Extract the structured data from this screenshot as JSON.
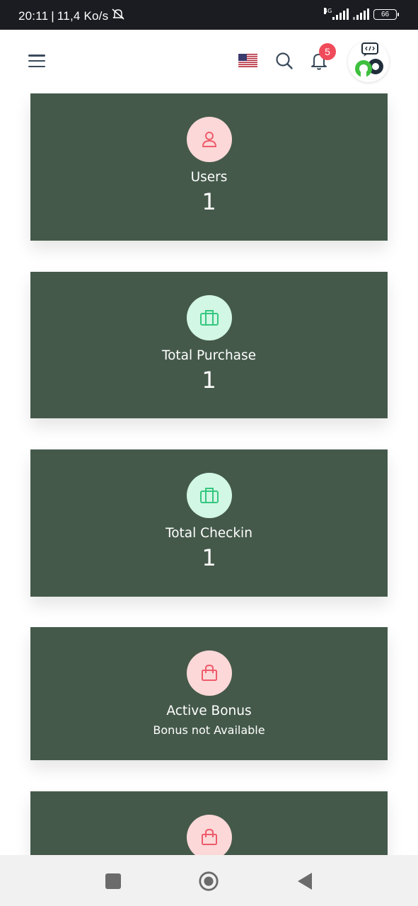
{
  "status_bar": {
    "time": "20:11",
    "speed": "11,4 Ko/s",
    "network": "4G",
    "battery": "66"
  },
  "topbar": {
    "notification_count": "5",
    "language": "en-US"
  },
  "cards": [
    {
      "label": "Users",
      "value": "1",
      "icon": "user-icon",
      "icon_bg": "#fcd8d8",
      "icon_color": "#ef5b6b"
    },
    {
      "label": "Total Purchase",
      "value": "1",
      "icon": "briefcase-icon",
      "icon_bg": "#d2f7e4",
      "icon_color": "#34c77f"
    },
    {
      "label": "Total Checkin",
      "value": "1",
      "icon": "briefcase-icon",
      "icon_bg": "#d2f7e4",
      "icon_color": "#34c77f"
    },
    {
      "label": "Active Bonus",
      "value": "Bonus not Available",
      "icon": "shopping-bag-icon",
      "icon_bg": "#fcd8d8",
      "icon_color": "#ef5b6b"
    },
    {
      "label": "",
      "value": "",
      "icon": "shopping-bag-icon",
      "icon_bg": "#fcd8d8",
      "icon_color": "#ef5b6b"
    }
  ],
  "colors": {
    "card_bg": "#44594a",
    "status_bar_bg": "#1a1c21",
    "badge": "#ef4b5a"
  }
}
